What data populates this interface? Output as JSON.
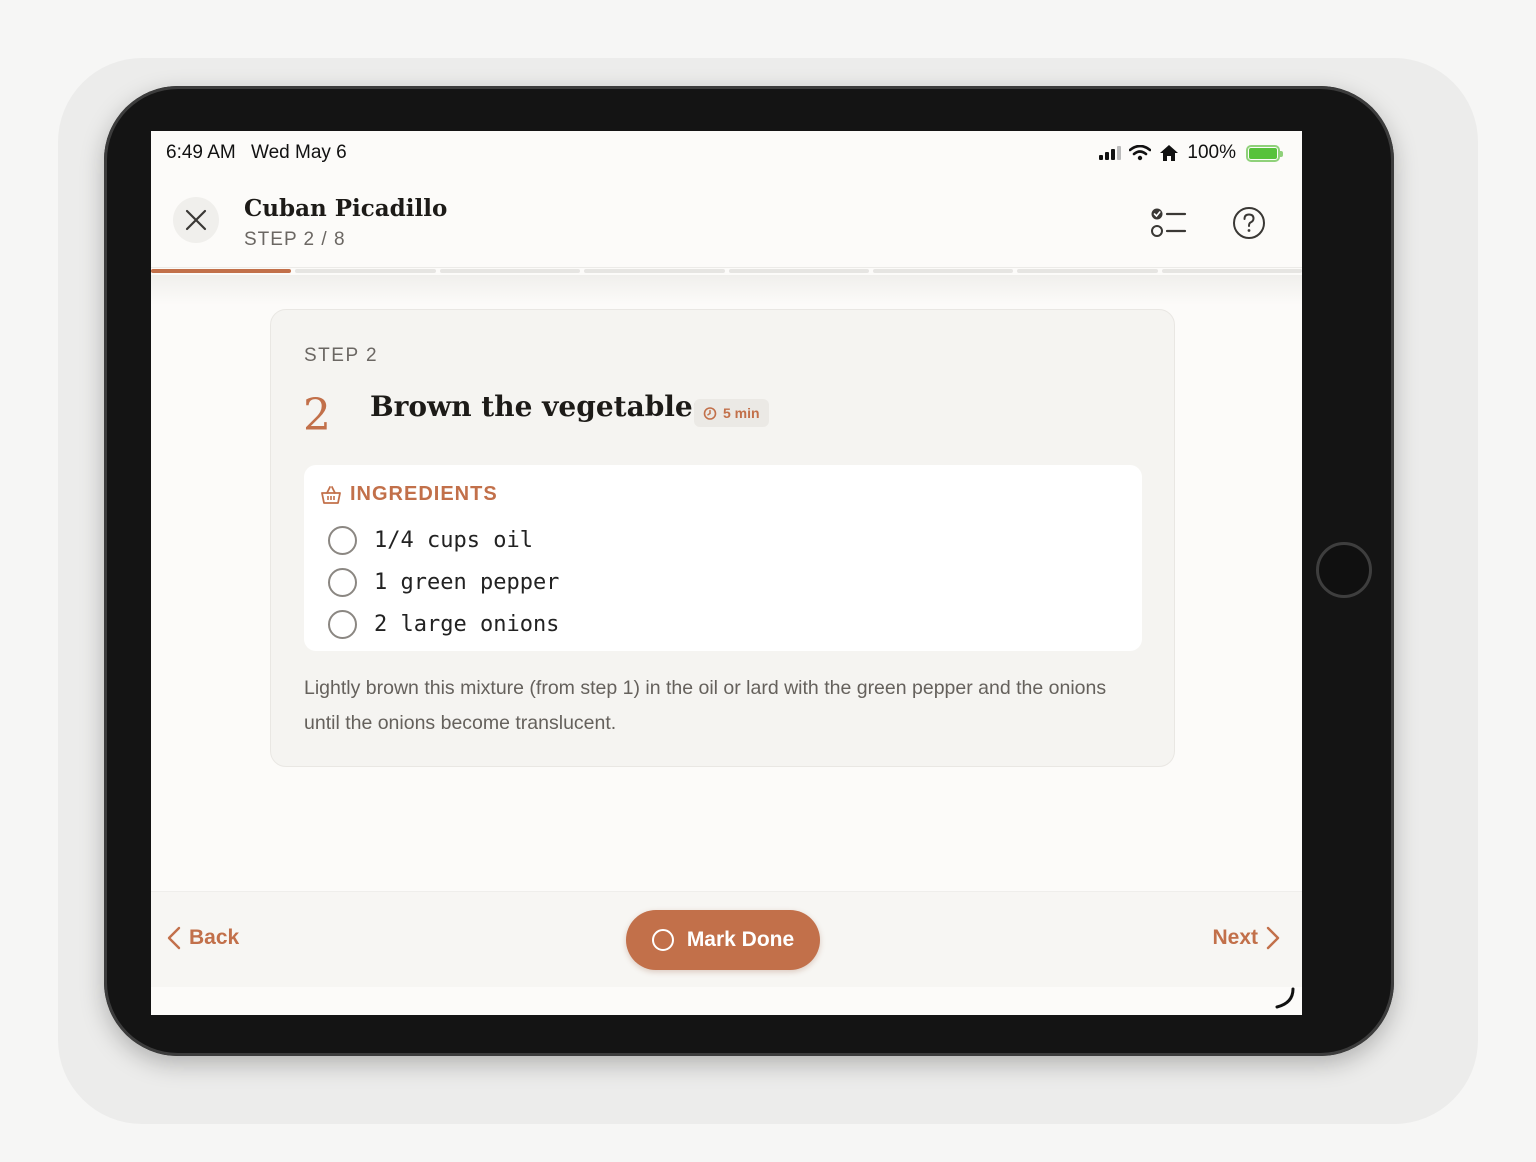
{
  "status_bar": {
    "time": "6:49 AM",
    "date": "Wed May 6",
    "battery": "100%",
    "icons": [
      "signal-icon",
      "wifi-icon",
      "home-icon",
      "battery-charging-icon"
    ]
  },
  "header": {
    "recipe_title": "Cuban Picadillo",
    "step_counter": "STEP 2 / 8",
    "icons": [
      "close-icon",
      "checklist-icon",
      "help-icon"
    ]
  },
  "progress": {
    "current_step": 2,
    "total_steps": 8,
    "completed_segments": 1
  },
  "step": {
    "kicker": "STEP 2",
    "number": "2",
    "title": "Brown the vegetables",
    "time": "5 min",
    "ingredients_label": "INGREDIENTS",
    "ingredients": [
      {
        "text": "1/4 cups oil",
        "checked": false
      },
      {
        "text": "1 green pepper",
        "checked": false
      },
      {
        "text": "2 large onions",
        "checked": false
      }
    ],
    "description": "Lightly brown this mixture (from step 1) in the oil or lard with the green pepper and the onions until the onions become translucent."
  },
  "footer": {
    "back_label": "Back",
    "mark_done_label": "Mark Done",
    "next_label": "Next"
  },
  "colors": {
    "accent": "#c2704a",
    "background": "#fcfbf9",
    "card": "#f5f4f1",
    "text": "#1d1b18",
    "muted": "#6b6763"
  }
}
